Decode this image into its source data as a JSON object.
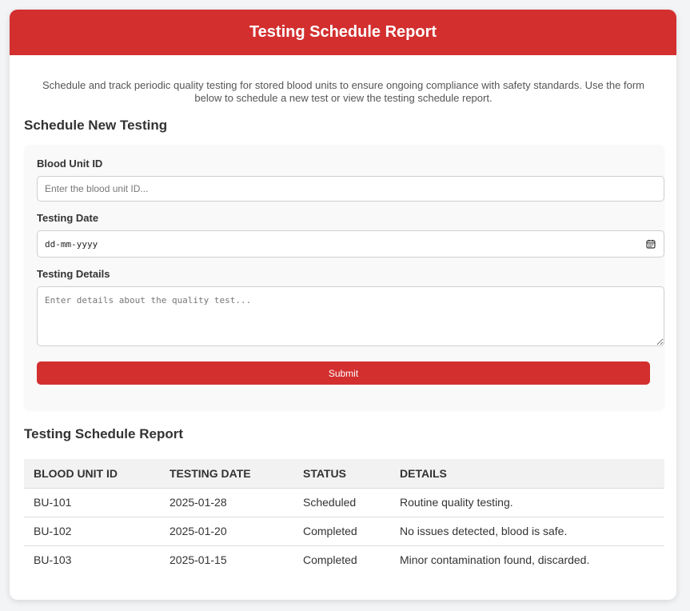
{
  "header": {
    "title": "Testing Schedule Report"
  },
  "intro": {
    "text": "Schedule and track periodic quality testing for stored blood units to ensure ongoing compliance with safety standards. Use the form below to schedule a new test or view the testing schedule report."
  },
  "form": {
    "title": "Schedule New Testing",
    "blood_unit_label": "Blood Unit ID",
    "blood_unit_placeholder": "Enter the blood unit ID...",
    "blood_unit_value": "",
    "testing_date_label": "Testing Date",
    "testing_date_value": "dd-mm-yyyy",
    "testing_date_icon": "calendar-icon",
    "testing_details_label": "Testing Details",
    "testing_details_placeholder": "Enter details about the quality test...",
    "testing_details_value": "",
    "submit_label": "Submit"
  },
  "report": {
    "title": "Testing Schedule Report",
    "columns": [
      "Blood Unit ID",
      "Testing Date",
      "Status",
      "Details"
    ],
    "rows": [
      {
        "id": "BU-101",
        "date": "2025-01-28",
        "status": "Scheduled",
        "details": "Routine quality testing."
      },
      {
        "id": "BU-102",
        "date": "2025-01-20",
        "status": "Completed",
        "details": "No issues detected, blood is safe."
      },
      {
        "id": "BU-103",
        "date": "2025-01-15",
        "status": "Completed",
        "details": "Minor contamination found, discarded."
      }
    ]
  },
  "colors": {
    "accent": "#d32f2f",
    "page_background": "#f3f4f6",
    "panel_background": "#f9f9f9",
    "table_header_background": "#f2f2f2"
  }
}
